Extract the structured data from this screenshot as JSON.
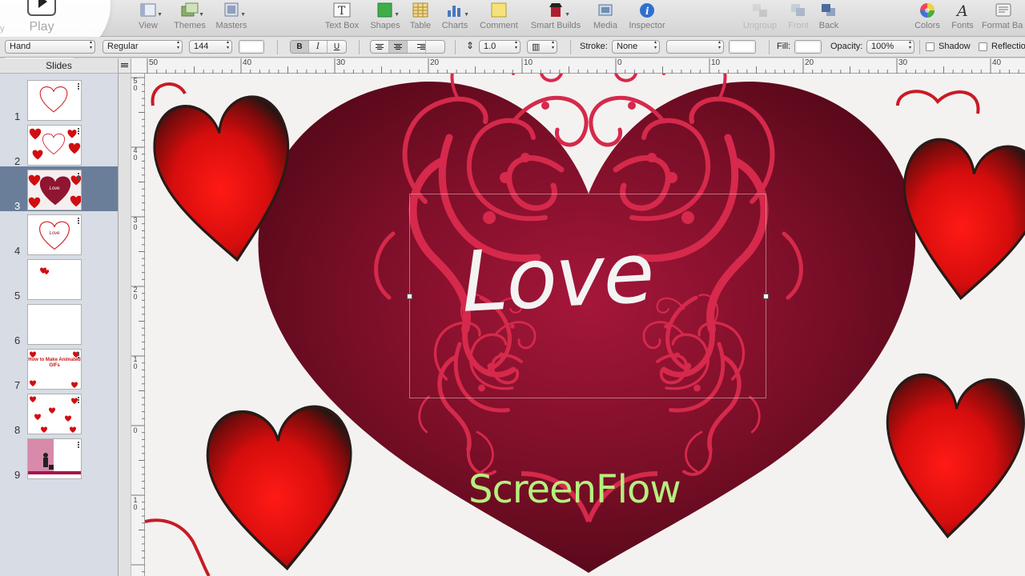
{
  "toolbar": {
    "play_label": "Play",
    "left_partial_label": "y",
    "items": [
      {
        "label": "View",
        "icon": "view-icon",
        "dim": false
      },
      {
        "label": "Themes",
        "icon": "themes-icon",
        "dim": false
      },
      {
        "label": "Masters",
        "icon": "masters-icon",
        "dim": false
      },
      {
        "label": "Text Box",
        "icon": "text-box-icon",
        "dim": false
      },
      {
        "label": "Shapes",
        "icon": "shapes-icon",
        "dim": false
      },
      {
        "label": "Table",
        "icon": "table-icon",
        "dim": false
      },
      {
        "label": "Charts",
        "icon": "charts-icon",
        "dim": false
      },
      {
        "label": "Comment",
        "icon": "comment-icon",
        "dim": false
      },
      {
        "label": "Smart Builds",
        "icon": "smart-builds-icon",
        "dim": false
      },
      {
        "label": "Media",
        "icon": "media-icon",
        "dim": false
      },
      {
        "label": "Inspector",
        "icon": "inspector-icon",
        "dim": false
      },
      {
        "label": "Ungroup",
        "icon": "ungroup-icon",
        "dim": true
      },
      {
        "label": "Front",
        "icon": "front-icon",
        "dim": true
      },
      {
        "label": "Back",
        "icon": "back-icon",
        "dim": false
      },
      {
        "label": "Colors",
        "icon": "colors-icon",
        "dim": false
      },
      {
        "label": "Fonts",
        "icon": "fonts-icon",
        "dim": false
      },
      {
        "label": "Format Ba",
        "icon": "format-bar-icon",
        "dim": false
      }
    ]
  },
  "format_bar": {
    "font_family": "Hand",
    "font_style": "Regular",
    "font_size": "144",
    "bold": "B",
    "italic": "I",
    "underline": "U",
    "line_spacing": "1.0",
    "stroke_label": "Stroke:",
    "stroke_value": "None",
    "fill_label": "Fill:",
    "opacity_label": "Opacity:",
    "opacity_value": "100%",
    "shadow_label": "Shadow",
    "reflection_label": "Reflectio"
  },
  "sidebar": {
    "header": "Slides",
    "selected": 3,
    "slides": [
      {
        "number": "1",
        "text": ""
      },
      {
        "number": "2",
        "text": ""
      },
      {
        "number": "3",
        "text": "Love"
      },
      {
        "number": "4",
        "text": "Love"
      },
      {
        "number": "5",
        "text": ""
      },
      {
        "number": "6",
        "text": ""
      },
      {
        "number": "7",
        "text": "How to Make Animated GIFs"
      },
      {
        "number": "8",
        "text": ""
      },
      {
        "number": "9",
        "text": ""
      }
    ]
  },
  "ruler": {
    "top": [
      "50",
      "40",
      "30",
      "20",
      "10",
      "0",
      "10",
      "20",
      "30",
      "40"
    ],
    "left": [
      "5 0",
      "4 0",
      "3 0",
      "2 0",
      "1 0",
      "0",
      "1 0"
    ]
  },
  "slide": {
    "main_text": "Love",
    "watermark": "ScreenFlow"
  },
  "colors": {
    "heart_dark": "#6a0e22",
    "heart_mid": "#8f1530",
    "swirl": "#d6294b",
    "small_heart": "#d10d10",
    "watermark": "#b6ef7f",
    "selection": "#6a7e9a"
  }
}
